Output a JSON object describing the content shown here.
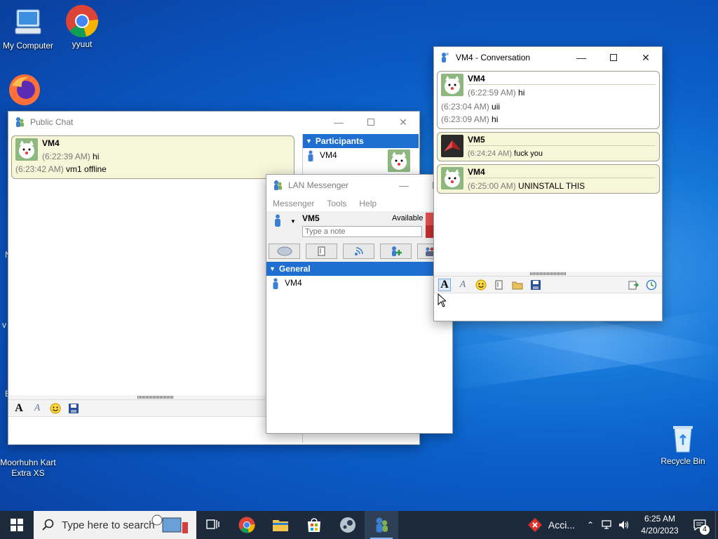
{
  "desktop": {
    "icons": [
      {
        "label": "My Computer"
      },
      {
        "label": "yyuut"
      },
      {
        "label": "Moorhuhn Kart Extra XS"
      },
      {
        "label": "Recycle Bin"
      }
    ],
    "partial_labels": [
      "N",
      "v",
      "E"
    ]
  },
  "public_chat": {
    "title": "Public Chat",
    "messages": [
      {
        "sender": "VM4",
        "lines": [
          {
            "time": "(6:22:39 AM)",
            "text": "hi"
          },
          {
            "time": "(6:23:42 AM)",
            "text": "vm1 offline"
          }
        ]
      }
    ],
    "participants_header": "Participants",
    "participants": [
      {
        "name": "VM4"
      }
    ]
  },
  "lan_messenger": {
    "title": "LAN Messenger",
    "menu": [
      "Messenger",
      "Tools",
      "Help"
    ],
    "user": {
      "name": "VM5",
      "status": "Available",
      "note_placeholder": "Type a note"
    },
    "group": "General",
    "contacts": [
      {
        "name": "VM4"
      }
    ]
  },
  "conversation": {
    "title": "VM4 - Conversation",
    "messages": [
      {
        "sender": "VM4",
        "lines": [
          {
            "time": "(6:22:59 AM)",
            "text": "hi"
          },
          {
            "time": "(6:23:04 AM)",
            "text": "uii"
          },
          {
            "time": "(6:23:09 AM)",
            "text": "hi"
          }
        ]
      },
      {
        "sender": "VM5",
        "lines": [
          {
            "time": "(6:24:24 AM)",
            "text": "fuck you"
          }
        ]
      },
      {
        "sender": "VM4",
        "lines": [
          {
            "time": "(6:25:00 AM)",
            "text": "UNINSTALL THIS"
          }
        ]
      }
    ]
  },
  "taskbar": {
    "search_placeholder": "Type here to search",
    "tray_app": "Acci...",
    "time": "6:25 AM",
    "date": "4/20/2023",
    "notification_count": "4"
  },
  "colors": {
    "accent": "#1f6fd0",
    "bubble": "#f6f6d9",
    "taskbar": "#1c2a3c"
  }
}
